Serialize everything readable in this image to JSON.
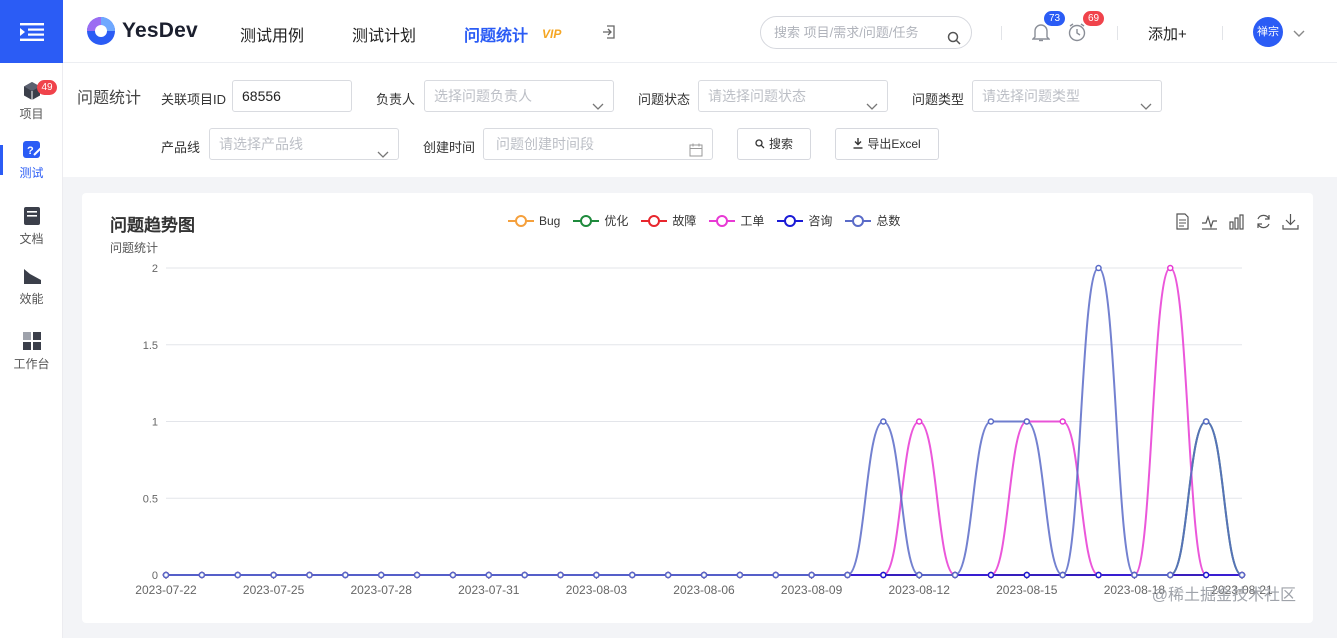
{
  "rail": {
    "items": [
      {
        "label": "项目",
        "icon": "cube-icon",
        "badge": "49"
      },
      {
        "label": "测试",
        "icon": "test-icon",
        "badge": ""
      },
      {
        "label": "文档",
        "icon": "document-icon",
        "badge": ""
      },
      {
        "label": "效能",
        "icon": "efficiency-icon",
        "badge": ""
      },
      {
        "label": "工作台",
        "icon": "workbench-icon",
        "badge": ""
      }
    ]
  },
  "header": {
    "logo_text": "YesDev",
    "nav": [
      "测试用例",
      "测试计划",
      "问题统计"
    ],
    "vip": "VIP",
    "search_placeholder": "搜索 项目/需求/问题/任务",
    "bell_badge": "73",
    "clock_badge": "69",
    "add_label": "添加+",
    "avatar_text": "禅宗"
  },
  "filters": {
    "panel_title": "问题统计",
    "project_id_label": "关联项目ID",
    "project_id_value": "68556",
    "assignee_label": "负责人",
    "assignee_placeholder": "选择问题负责人",
    "status_label": "问题状态",
    "status_placeholder": "请选择问题状态",
    "type_label": "问题类型",
    "type_placeholder": "请选择问题类型",
    "product_label": "产品线",
    "product_placeholder": "请选择产品线",
    "created_label": "创建时间",
    "created_placeholder": "问题创建时间段",
    "search_btn": "搜索",
    "export_btn": "导出Excel"
  },
  "chart": {
    "title": "问题趋势图",
    "y_unit": "问题统计",
    "watermark": "@稀土掘金技术社区"
  },
  "chart_data": {
    "type": "line",
    "title": "问题趋势图",
    "ylabel": "问题统计",
    "ylim": [
      0,
      2
    ],
    "yticks": [
      "0",
      "0.5",
      "1",
      "1.5",
      "2"
    ],
    "legend_position": "top",
    "x": [
      "2023-07-22",
      "2023-07-23",
      "2023-07-24",
      "2023-07-25",
      "2023-07-26",
      "2023-07-27",
      "2023-07-28",
      "2023-07-29",
      "2023-07-30",
      "2023-07-31",
      "2023-08-01",
      "2023-08-02",
      "2023-08-03",
      "2023-08-04",
      "2023-08-05",
      "2023-08-06",
      "2023-08-07",
      "2023-08-08",
      "2023-08-09",
      "2023-08-10",
      "2023-08-11",
      "2023-08-12",
      "2023-08-13",
      "2023-08-14",
      "2023-08-15",
      "2023-08-16",
      "2023-08-17",
      "2023-08-18",
      "2023-08-19",
      "2023-08-20",
      "2023-08-21"
    ],
    "x_tick_labels": [
      "2023-07-22",
      "2023-07-25",
      "2023-07-28",
      "2023-07-31",
      "2023-08-03",
      "2023-08-06",
      "2023-08-09",
      "2023-08-12",
      "2023-08-15",
      "2023-08-18",
      "2023-08-21"
    ],
    "series": [
      {
        "name": "Bug",
        "color": "#f5a03c",
        "values": [
          0,
          0,
          0,
          0,
          0,
          0,
          0,
          0,
          0,
          0,
          0,
          0,
          0,
          0,
          0,
          0,
          0,
          0,
          0,
          0,
          0,
          0,
          0,
          0,
          0,
          0,
          0,
          0,
          0,
          0,
          0
        ]
      },
      {
        "name": "优化",
        "color": "#1e8a3c",
        "values": [
          0,
          0,
          0,
          0,
          0,
          0,
          0,
          0,
          0,
          0,
          0,
          0,
          0,
          0,
          0,
          0,
          0,
          0,
          0,
          0,
          0,
          0,
          0,
          0,
          0,
          0,
          0,
          0,
          0,
          1,
          0
        ]
      },
      {
        "name": "故障",
        "color": "#e8262d",
        "values": [
          0,
          0,
          0,
          0,
          0,
          0,
          0,
          0,
          0,
          0,
          0,
          0,
          0,
          0,
          0,
          0,
          0,
          0,
          0,
          0,
          0,
          0,
          0,
          0,
          0,
          0,
          0,
          0,
          0,
          0,
          0
        ]
      },
      {
        "name": "工单",
        "color": "#e839d4",
        "values": [
          0,
          0,
          0,
          0,
          0,
          0,
          0,
          0,
          0,
          0,
          0,
          0,
          0,
          0,
          0,
          0,
          0,
          0,
          0,
          0,
          0,
          1,
          0,
          0,
          1,
          1,
          0,
          0,
          2,
          0,
          0
        ]
      },
      {
        "name": "咨询",
        "color": "#1a1ad6",
        "values": [
          0,
          0,
          0,
          0,
          0,
          0,
          0,
          0,
          0,
          0,
          0,
          0,
          0,
          0,
          0,
          0,
          0,
          0,
          0,
          0,
          0,
          0,
          0,
          0,
          0,
          0,
          0,
          0,
          0,
          0,
          0
        ]
      },
      {
        "name": "总数",
        "color": "#5a6bc8",
        "values": [
          0,
          0,
          0,
          0,
          0,
          0,
          0,
          0,
          0,
          0,
          0,
          0,
          0,
          0,
          0,
          0,
          0,
          0,
          0,
          0,
          1,
          0,
          0,
          1,
          1,
          0,
          2,
          0,
          0,
          1,
          0
        ]
      }
    ]
  }
}
